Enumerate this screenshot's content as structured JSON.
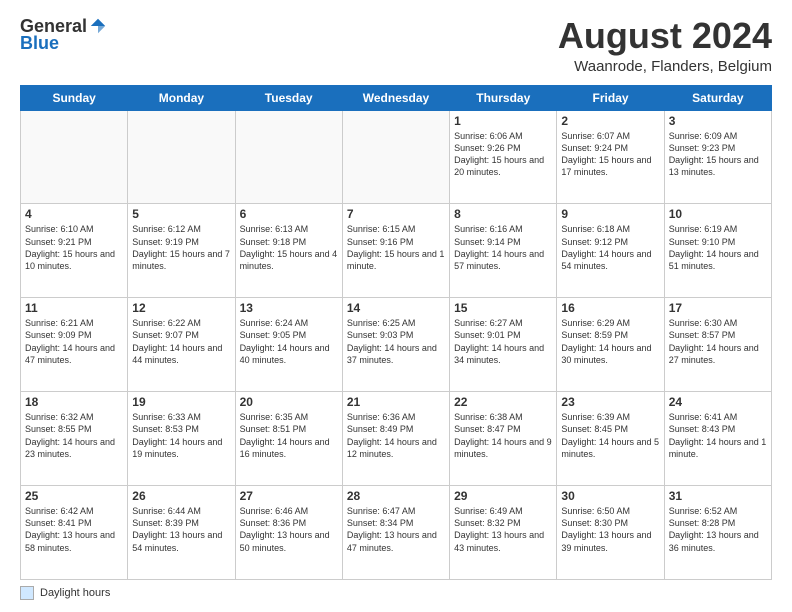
{
  "header": {
    "logo_general": "General",
    "logo_blue": "Blue",
    "month_year": "August 2024",
    "location": "Waanrode, Flanders, Belgium"
  },
  "days_of_week": [
    "Sunday",
    "Monday",
    "Tuesday",
    "Wednesday",
    "Thursday",
    "Friday",
    "Saturday"
  ],
  "weeks": [
    [
      {
        "day": "",
        "info": ""
      },
      {
        "day": "",
        "info": ""
      },
      {
        "day": "",
        "info": ""
      },
      {
        "day": "",
        "info": ""
      },
      {
        "day": "1",
        "info": "Sunrise: 6:06 AM\nSunset: 9:26 PM\nDaylight: 15 hours\nand 20 minutes."
      },
      {
        "day": "2",
        "info": "Sunrise: 6:07 AM\nSunset: 9:24 PM\nDaylight: 15 hours\nand 17 minutes."
      },
      {
        "day": "3",
        "info": "Sunrise: 6:09 AM\nSunset: 9:23 PM\nDaylight: 15 hours\nand 13 minutes."
      }
    ],
    [
      {
        "day": "4",
        "info": "Sunrise: 6:10 AM\nSunset: 9:21 PM\nDaylight: 15 hours\nand 10 minutes."
      },
      {
        "day": "5",
        "info": "Sunrise: 6:12 AM\nSunset: 9:19 PM\nDaylight: 15 hours\nand 7 minutes."
      },
      {
        "day": "6",
        "info": "Sunrise: 6:13 AM\nSunset: 9:18 PM\nDaylight: 15 hours\nand 4 minutes."
      },
      {
        "day": "7",
        "info": "Sunrise: 6:15 AM\nSunset: 9:16 PM\nDaylight: 15 hours\nand 1 minute."
      },
      {
        "day": "8",
        "info": "Sunrise: 6:16 AM\nSunset: 9:14 PM\nDaylight: 14 hours\nand 57 minutes."
      },
      {
        "day": "9",
        "info": "Sunrise: 6:18 AM\nSunset: 9:12 PM\nDaylight: 14 hours\nand 54 minutes."
      },
      {
        "day": "10",
        "info": "Sunrise: 6:19 AM\nSunset: 9:10 PM\nDaylight: 14 hours\nand 51 minutes."
      }
    ],
    [
      {
        "day": "11",
        "info": "Sunrise: 6:21 AM\nSunset: 9:09 PM\nDaylight: 14 hours\nand 47 minutes."
      },
      {
        "day": "12",
        "info": "Sunrise: 6:22 AM\nSunset: 9:07 PM\nDaylight: 14 hours\nand 44 minutes."
      },
      {
        "day": "13",
        "info": "Sunrise: 6:24 AM\nSunset: 9:05 PM\nDaylight: 14 hours\nand 40 minutes."
      },
      {
        "day": "14",
        "info": "Sunrise: 6:25 AM\nSunset: 9:03 PM\nDaylight: 14 hours\nand 37 minutes."
      },
      {
        "day": "15",
        "info": "Sunrise: 6:27 AM\nSunset: 9:01 PM\nDaylight: 14 hours\nand 34 minutes."
      },
      {
        "day": "16",
        "info": "Sunrise: 6:29 AM\nSunset: 8:59 PM\nDaylight: 14 hours\nand 30 minutes."
      },
      {
        "day": "17",
        "info": "Sunrise: 6:30 AM\nSunset: 8:57 PM\nDaylight: 14 hours\nand 27 minutes."
      }
    ],
    [
      {
        "day": "18",
        "info": "Sunrise: 6:32 AM\nSunset: 8:55 PM\nDaylight: 14 hours\nand 23 minutes."
      },
      {
        "day": "19",
        "info": "Sunrise: 6:33 AM\nSunset: 8:53 PM\nDaylight: 14 hours\nand 19 minutes."
      },
      {
        "day": "20",
        "info": "Sunrise: 6:35 AM\nSunset: 8:51 PM\nDaylight: 14 hours\nand 16 minutes."
      },
      {
        "day": "21",
        "info": "Sunrise: 6:36 AM\nSunset: 8:49 PM\nDaylight: 14 hours\nand 12 minutes."
      },
      {
        "day": "22",
        "info": "Sunrise: 6:38 AM\nSunset: 8:47 PM\nDaylight: 14 hours\nand 9 minutes."
      },
      {
        "day": "23",
        "info": "Sunrise: 6:39 AM\nSunset: 8:45 PM\nDaylight: 14 hours\nand 5 minutes."
      },
      {
        "day": "24",
        "info": "Sunrise: 6:41 AM\nSunset: 8:43 PM\nDaylight: 14 hours\nand 1 minute."
      }
    ],
    [
      {
        "day": "25",
        "info": "Sunrise: 6:42 AM\nSunset: 8:41 PM\nDaylight: 13 hours\nand 58 minutes."
      },
      {
        "day": "26",
        "info": "Sunrise: 6:44 AM\nSunset: 8:39 PM\nDaylight: 13 hours\nand 54 minutes."
      },
      {
        "day": "27",
        "info": "Sunrise: 6:46 AM\nSunset: 8:36 PM\nDaylight: 13 hours\nand 50 minutes."
      },
      {
        "day": "28",
        "info": "Sunrise: 6:47 AM\nSunset: 8:34 PM\nDaylight: 13 hours\nand 47 minutes."
      },
      {
        "day": "29",
        "info": "Sunrise: 6:49 AM\nSunset: 8:32 PM\nDaylight: 13 hours\nand 43 minutes."
      },
      {
        "day": "30",
        "info": "Sunrise: 6:50 AM\nSunset: 8:30 PM\nDaylight: 13 hours\nand 39 minutes."
      },
      {
        "day": "31",
        "info": "Sunrise: 6:52 AM\nSunset: 8:28 PM\nDaylight: 13 hours\nand 36 minutes."
      }
    ]
  ],
  "footer": {
    "legend_label": "Daylight hours"
  }
}
